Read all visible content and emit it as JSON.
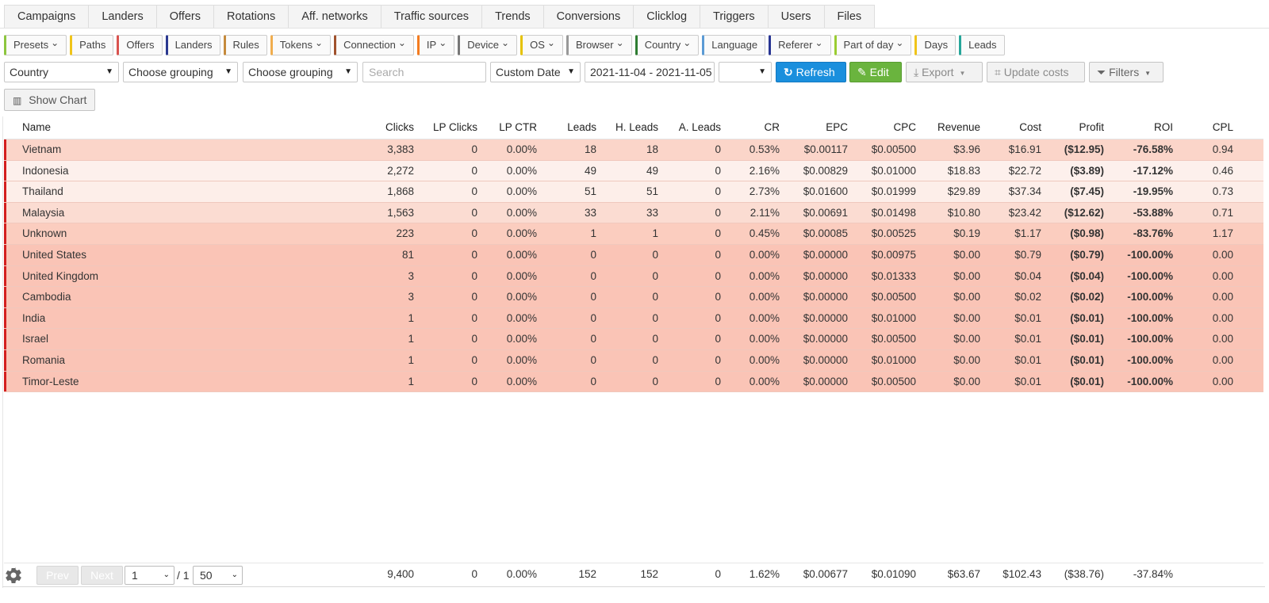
{
  "nav_tabs": [
    "Campaigns",
    "Landers",
    "Offers",
    "Rotations",
    "Aff. networks",
    "Traffic sources",
    "Trends",
    "Conversions",
    "Clicklog",
    "Triggers",
    "Users",
    "Files"
  ],
  "report_buttons": [
    {
      "label": "Presets",
      "caret": true,
      "color": "#8dc63f"
    },
    {
      "label": "Paths",
      "caret": false,
      "color": "#f0c419"
    },
    {
      "label": "Offers",
      "caret": false,
      "color": "#d9534f"
    },
    {
      "label": "Landers",
      "caret": false,
      "color": "#2b3990"
    },
    {
      "label": "Rules",
      "caret": false,
      "color": "#c58a3c"
    },
    {
      "label": "Tokens",
      "caret": true,
      "color": "#f0ad4e"
    },
    {
      "label": "Connection",
      "caret": true,
      "color": "#a0522d"
    },
    {
      "label": "IP",
      "caret": true,
      "color": "#f47c20"
    },
    {
      "label": "Device",
      "caret": true,
      "color": "#777777"
    },
    {
      "label": "OS",
      "caret": true,
      "color": "#e6c200"
    },
    {
      "label": "Browser",
      "caret": true,
      "color": "#999999"
    },
    {
      "label": "Country",
      "caret": true,
      "color": "#2e7d32"
    },
    {
      "label": "Language",
      "caret": false,
      "color": "#5b9bd5"
    },
    {
      "label": "Referer",
      "caret": true,
      "color": "#283593"
    },
    {
      "label": "Part of day",
      "caret": true,
      "color": "#9acd32"
    },
    {
      "label": "Days",
      "caret": false,
      "color": "#f0c419"
    },
    {
      "label": "Leads",
      "caret": false,
      "color": "#26a69a"
    }
  ],
  "filters": {
    "grouping1": "Country",
    "grouping2": "Choose grouping",
    "grouping3": "Choose grouping",
    "search_placeholder": "Search",
    "date_mode": "Custom Date",
    "date_range": "2021-11-04 - 2021-11-05",
    "timezone": ""
  },
  "buttons": {
    "refresh": "Refresh",
    "edit": "Edit",
    "export": "Export",
    "update_costs": "Update costs",
    "filters": "Filters",
    "show_chart": "Show Chart"
  },
  "table": {
    "headers": [
      "Name",
      "Clicks",
      "LP Clicks",
      "LP CTR",
      "Leads",
      "H. Leads",
      "A. Leads",
      "CR",
      "EPC",
      "CPC",
      "Revenue",
      "Cost",
      "Profit",
      "ROI",
      "CPL"
    ],
    "rows": [
      {
        "bg": "#fbd5c9",
        "cells": [
          "Vietnam",
          "3,383",
          "0",
          "0.00%",
          "18",
          "18",
          "0",
          "0.53%",
          "$0.00117",
          "$0.00500",
          "$3.96",
          "$16.91",
          "($12.95)",
          "-76.58%",
          "0.94"
        ]
      },
      {
        "bg": "#fdf0ec",
        "cells": [
          "Indonesia",
          "2,272",
          "0",
          "0.00%",
          "49",
          "49",
          "0",
          "2.16%",
          "$0.00829",
          "$0.01000",
          "$18.83",
          "$22.72",
          "($3.89)",
          "-17.12%",
          "0.46"
        ]
      },
      {
        "bg": "#fdeee9",
        "cells": [
          "Thailand",
          "1,868",
          "0",
          "0.00%",
          "51",
          "51",
          "0",
          "2.73%",
          "$0.01600",
          "$0.01999",
          "$29.89",
          "$37.34",
          "($7.45)",
          "-19.95%",
          "0.73"
        ]
      },
      {
        "bg": "#fbdcd2",
        "cells": [
          "Malaysia",
          "1,563",
          "0",
          "0.00%",
          "33",
          "33",
          "0",
          "2.11%",
          "$0.00691",
          "$0.01498",
          "$10.80",
          "$23.42",
          "($12.62)",
          "-53.88%",
          "0.71"
        ]
      },
      {
        "bg": "#fbcdbf",
        "cells": [
          "Unknown",
          "223",
          "0",
          "0.00%",
          "1",
          "1",
          "0",
          "0.45%",
          "$0.00085",
          "$0.00525",
          "$0.19",
          "$1.17",
          "($0.98)",
          "-83.76%",
          "1.17"
        ]
      },
      {
        "bg": "#fac4b6",
        "cells": [
          "United States",
          "81",
          "0",
          "0.00%",
          "0",
          "0",
          "0",
          "0.00%",
          "$0.00000",
          "$0.00975",
          "$0.00",
          "$0.79",
          "($0.79)",
          "-100.00%",
          "0.00"
        ]
      },
      {
        "bg": "#fac4b6",
        "cells": [
          "United Kingdom",
          "3",
          "0",
          "0.00%",
          "0",
          "0",
          "0",
          "0.00%",
          "$0.00000",
          "$0.01333",
          "$0.00",
          "$0.04",
          "($0.04)",
          "-100.00%",
          "0.00"
        ]
      },
      {
        "bg": "#fac4b6",
        "cells": [
          "Cambodia",
          "3",
          "0",
          "0.00%",
          "0",
          "0",
          "0",
          "0.00%",
          "$0.00000",
          "$0.00500",
          "$0.00",
          "$0.02",
          "($0.02)",
          "-100.00%",
          "0.00"
        ]
      },
      {
        "bg": "#fac4b6",
        "cells": [
          "India",
          "1",
          "0",
          "0.00%",
          "0",
          "0",
          "0",
          "0.00%",
          "$0.00000",
          "$0.01000",
          "$0.00",
          "$0.01",
          "($0.01)",
          "-100.00%",
          "0.00"
        ]
      },
      {
        "bg": "#fac4b6",
        "cells": [
          "Israel",
          "1",
          "0",
          "0.00%",
          "0",
          "0",
          "0",
          "0.00%",
          "$0.00000",
          "$0.00500",
          "$0.00",
          "$0.01",
          "($0.01)",
          "-100.00%",
          "0.00"
        ]
      },
      {
        "bg": "#fac4b6",
        "cells": [
          "Romania",
          "1",
          "0",
          "0.00%",
          "0",
          "0",
          "0",
          "0.00%",
          "$0.00000",
          "$0.01000",
          "$0.00",
          "$0.01",
          "($0.01)",
          "-100.00%",
          "0.00"
        ]
      },
      {
        "bg": "#fac4b6",
        "cells": [
          "Timor-Leste",
          "1",
          "0",
          "0.00%",
          "0",
          "0",
          "0",
          "0.00%",
          "$0.00000",
          "$0.00500",
          "$0.00",
          "$0.01",
          "($0.01)",
          "-100.00%",
          "0.00"
        ]
      }
    ],
    "totals": [
      "9,400",
      "0",
      "0.00%",
      "152",
      "152",
      "0",
      "1.62%",
      "$0.00677",
      "$0.01090",
      "$63.67",
      "$102.43",
      "($38.76)",
      "-37.84%",
      ""
    ]
  },
  "pagination": {
    "prev": "Prev",
    "next": "Next",
    "page": "1",
    "of": "/ 1",
    "per_page": "50"
  },
  "colors": {
    "accent_blue": "#1a8fdd",
    "accent_green": "#6ab43e",
    "negative_red": "#c0161c",
    "row_marker_red": "#d31f1f"
  }
}
